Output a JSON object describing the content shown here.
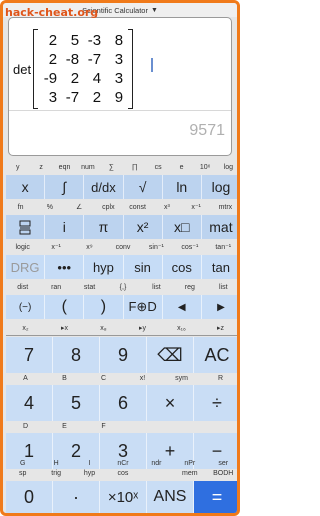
{
  "watermark": "hack-cheat.org",
  "app": {
    "title": "Scientific Calculator",
    "menu_icon": "triangle-down-icon"
  },
  "display": {
    "function": "det",
    "matrix": [
      [
        "2",
        "5",
        "-3",
        "8"
      ],
      [
        "2",
        "-8",
        "-7",
        "3"
      ],
      [
        "-9",
        "2",
        "4",
        "3"
      ],
      [
        "3",
        "-7",
        "2",
        "9"
      ]
    ],
    "result": "9571"
  },
  "rows": {
    "r1_labels": [
      "y",
      "z",
      "eqn",
      "num",
      "∑",
      "∏",
      "cs",
      "e",
      "10ˣ",
      "log"
    ],
    "r1_keys": [
      "x",
      "∫",
      "d/dx",
      "√",
      "ln",
      "log"
    ],
    "r2_labels": [
      "fn",
      "%",
      "∠",
      "cplx",
      "const",
      "x³",
      "x⁻¹",
      "mtrx"
    ],
    "r2_keys": [
      "",
      "i",
      "π",
      "x²",
      "x□",
      "mat"
    ],
    "r3_labels": [
      "logic",
      "x⁻¹",
      "x⁹",
      "conv",
      "sin⁻¹",
      "cos⁻¹",
      "tan⁻¹"
    ],
    "r3_keys": [
      "DRG",
      "•••",
      "hyp",
      "sin",
      "cos",
      "tan"
    ],
    "r4_labels": [
      "dist",
      "ran",
      "stat",
      "{,}",
      "list",
      "reg",
      "list"
    ],
    "r4_keys": [
      "(−)",
      "(",
      ")",
      "F⊕D",
      "◀",
      "▶"
    ],
    "r5_labels": [
      "x₂",
      "▸x",
      "x₈",
      "▸y",
      "x₁₆",
      "▸z"
    ],
    "r6_labels": [
      "A",
      "B",
      "C",
      "x!",
      "sym",
      "R"
    ],
    "r6_keys": [
      "7",
      "8",
      "9",
      "⌫",
      "AC"
    ],
    "r7_labels": [
      "D",
      "E",
      "F",
      "",
      "",
      ""
    ],
    "r7_keys": [
      "4",
      "5",
      "6",
      "×",
      "÷"
    ],
    "r8_labels": [
      "G",
      "H",
      "I",
      "nCr",
      "ndr",
      "nPr",
      "ser"
    ],
    "r8_keys": [
      "1",
      "2",
      "3",
      "+",
      "−"
    ],
    "r9_labels": [
      "sp",
      "trig",
      "hyp",
      "cos",
      "",
      "mem",
      "BODH"
    ],
    "r9_keys": [
      "0",
      "·",
      "×10ˣ",
      "ANS",
      "="
    ]
  }
}
